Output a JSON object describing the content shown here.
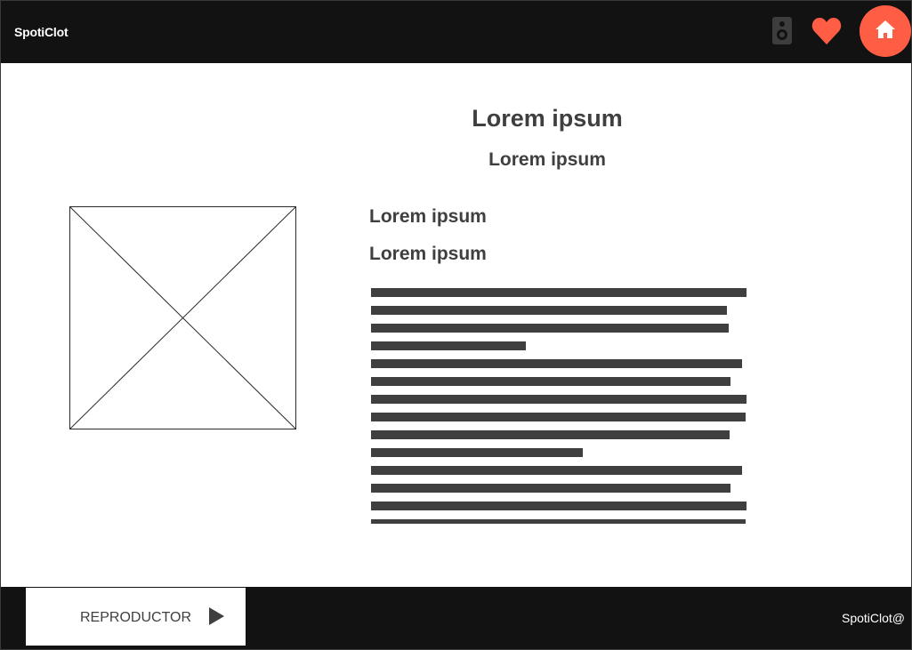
{
  "header": {
    "brand": "SpotiClot",
    "icons": [
      "speaker-icon",
      "heart-icon",
      "home-icon"
    ],
    "accent_color": "#ff5e45",
    "bar_color": "#121212"
  },
  "main": {
    "title": "Lorem ipsum",
    "subtitle": "Lorem ipsum",
    "line1": "Lorem ipsum",
    "line2": "Lorem ipsum",
    "image_placeholder_icon": "image-placeholder-icon",
    "text_lines_fill": [
      1.0,
      0.947,
      0.952,
      0.412,
      0.988,
      0.957,
      1.0,
      0.998,
      0.955,
      0.564,
      0.988,
      0.957,
      1.0,
      0.998
    ]
  },
  "footer": {
    "player_label": "REPRODUCTOR",
    "play_icon": "play-icon",
    "brand": "SpotiClot@"
  }
}
